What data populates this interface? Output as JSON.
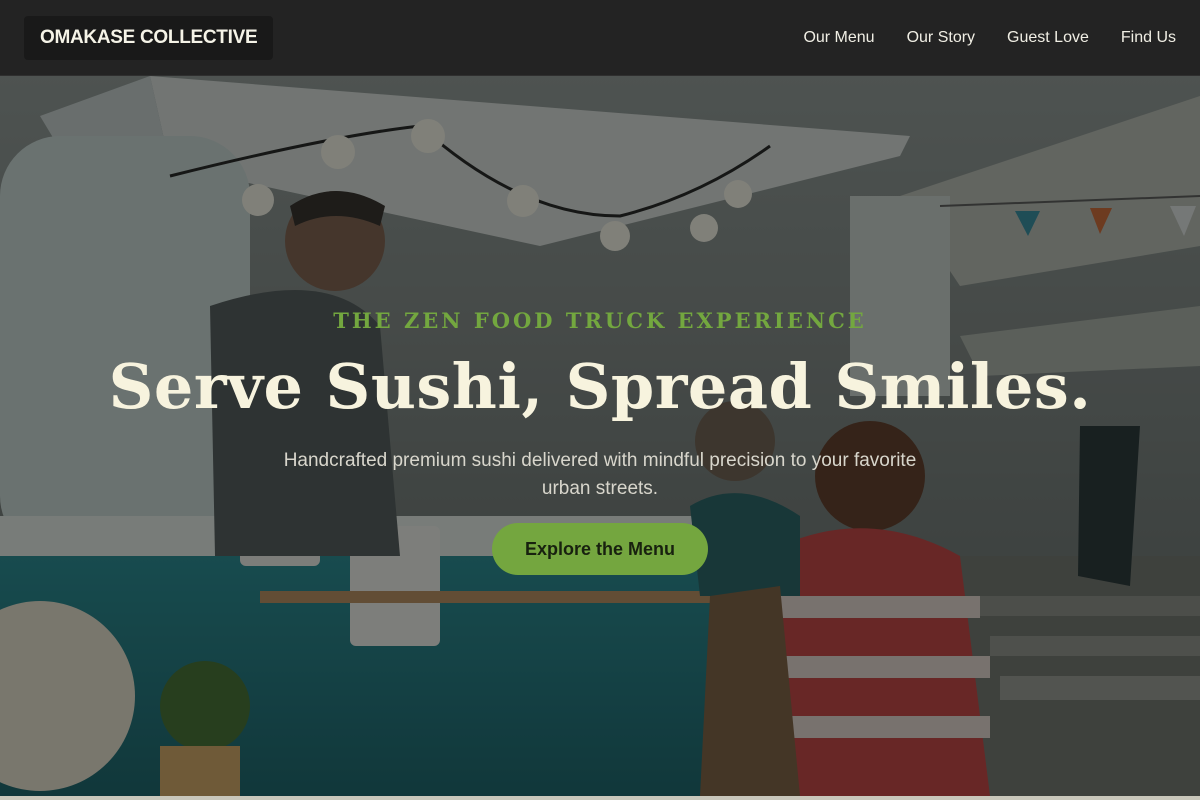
{
  "header": {
    "brand": "OMAKASE COLLECTIVE",
    "nav": [
      {
        "label": "Our Menu"
      },
      {
        "label": "Our Story"
      },
      {
        "label": "Guest Love"
      },
      {
        "label": "Find Us"
      }
    ]
  },
  "hero": {
    "eyebrow": "THE ZEN FOOD TRUCK EXPERIENCE",
    "headline": "Serve Sushi, Spread Smiles.",
    "subtext": "Handcrafted premium sushi delivered with mindful precision to your favorite urban streets.",
    "cta_label": "Explore the Menu",
    "background_image": "food-truck-market-photo"
  },
  "colors": {
    "header_bg": "#232323",
    "accent": "#74a63f",
    "headline": "#f7f3de"
  }
}
